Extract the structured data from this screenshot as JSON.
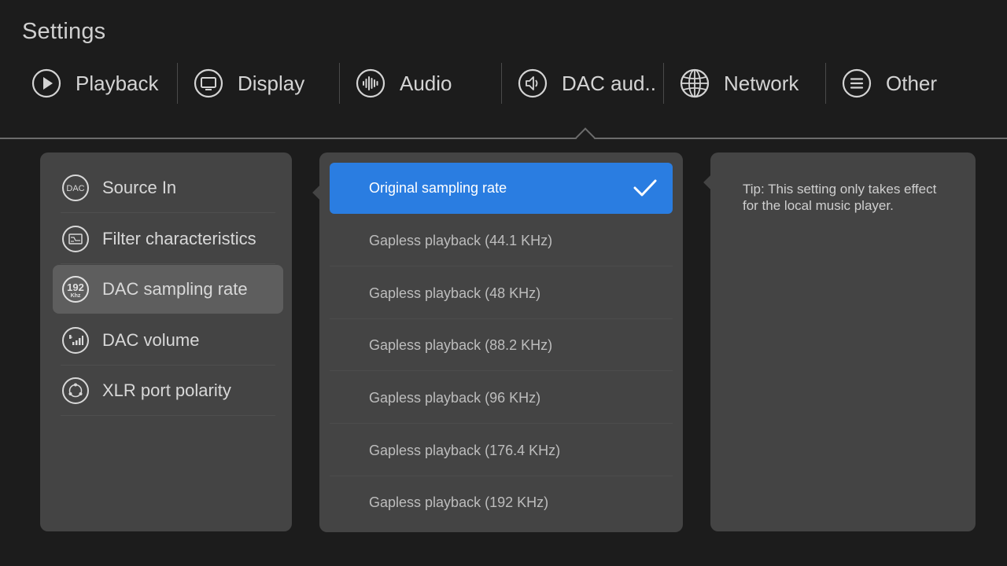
{
  "page": {
    "title": "Settings"
  },
  "tabs": [
    {
      "label": "Playback",
      "icon": "play-circle-icon"
    },
    {
      "label": "Display",
      "icon": "monitor-icon"
    },
    {
      "label": "Audio",
      "icon": "waveform-icon"
    },
    {
      "label": "DAC aud..",
      "icon": "speaker-icon"
    },
    {
      "label": "Network",
      "icon": "globe-icon"
    },
    {
      "label": "Other",
      "icon": "menu-lines-icon"
    }
  ],
  "sidebar": {
    "items": [
      {
        "label": "Source In",
        "icon": "dac-icon",
        "icon_text": "DAC"
      },
      {
        "label": "Filter characteristics",
        "icon": "filter-icon"
      },
      {
        "label": "DAC sampling rate",
        "icon": "sample-rate-icon",
        "icon_text": "192",
        "icon_subtext": "Khz",
        "active": true
      },
      {
        "label": "DAC volume",
        "icon": "volume-icon"
      },
      {
        "label": "XLR port polarity",
        "icon": "polarity-icon"
      }
    ]
  },
  "options": {
    "items": [
      {
        "label": "Original sampling rate",
        "selected": true
      },
      {
        "label": "Gapless playback (44.1 KHz)"
      },
      {
        "label": "Gapless playback (48 KHz)"
      },
      {
        "label": "Gapless playback (88.2 KHz)"
      },
      {
        "label": "Gapless playback (96 KHz)"
      },
      {
        "label": "Gapless playback (176.4 KHz)"
      },
      {
        "label": "Gapless playback (192 KHz)"
      }
    ]
  },
  "tip": {
    "text": "Tip: This setting only takes effect for the local music player."
  },
  "colors": {
    "background": "#1c1c1c",
    "panel": "#444444",
    "accent": "#2a7de1",
    "active_item": "#5e5e5e"
  }
}
